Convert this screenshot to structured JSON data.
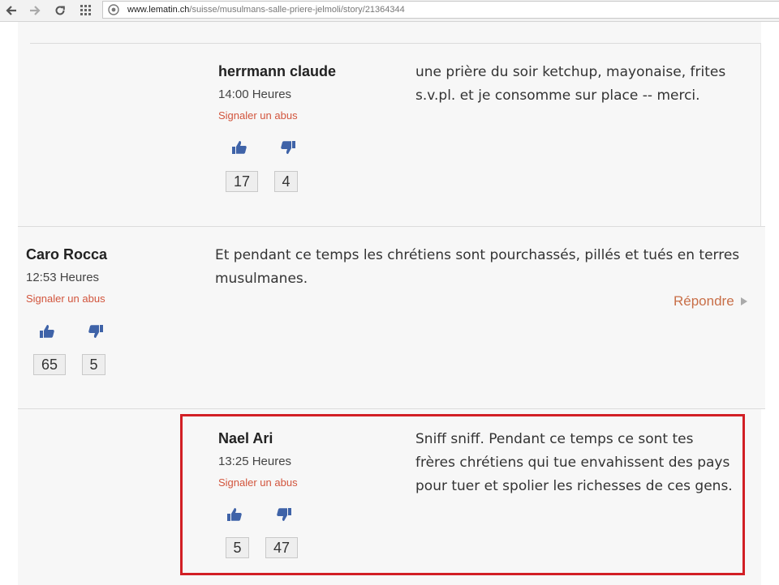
{
  "browser": {
    "url_host": "www.lematin.ch",
    "url_path": "/suisse/musulmans-salle-priere-jelmoli/story/21364344"
  },
  "comments": [
    {
      "author": "herrmann claude",
      "time": "14:00 Heures",
      "report_label": "Signaler un abus",
      "likes": "17",
      "dislikes": "4",
      "text": "une prière du soir ketchup, mayonaise, frites s.v.pl. et je consomme sur place -- merci."
    },
    {
      "author": "Caro Rocca",
      "time": "12:53 Heures",
      "report_label": "Signaler un abus",
      "likes": "65",
      "dislikes": "5",
      "text": "Et pendant ce temps les chrétiens sont pourchassés, pillés et tués en terres musulmanes.",
      "reply_label": "Répondre"
    },
    {
      "author": "Nael Ari",
      "time": "13:25 Heures",
      "report_label": "Signaler un abus",
      "likes": "5",
      "dislikes": "47",
      "text": "Sniff sniff. Pendant ce temps ce sont tes frères chrétiens qui tue envahissent des pays pour tuer et spolier les richesses de ces gens."
    }
  ],
  "colors": {
    "report_link": "#d2553d",
    "reply_link": "#c86f48",
    "highlight_border": "#d21f25",
    "vote_icon": "#3f63a8"
  }
}
